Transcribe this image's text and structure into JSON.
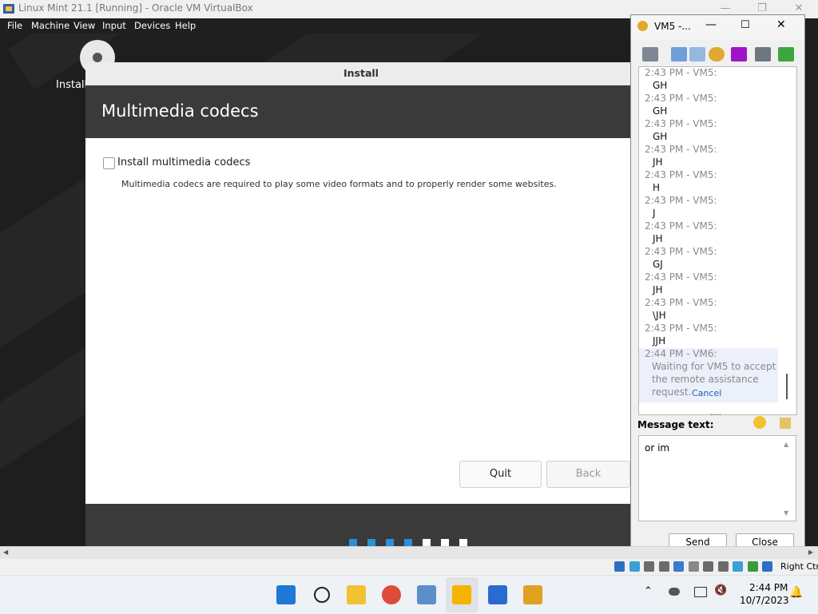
{
  "host_window": {
    "title": "Linux Mint 21.1 [Running] - Oracle VM VirtualBox",
    "menu": [
      "File",
      "Machine",
      "View",
      "Input",
      "Devices",
      "Help"
    ]
  },
  "desktop": {
    "icon_label": "Install"
  },
  "installer": {
    "window_title": "Install",
    "header": "Multimedia codecs",
    "checkbox_label": "Install multimedia codecs",
    "checkbox_checked": false,
    "description": "Multimedia codecs are required to play some video formats and to properly render some websites.",
    "buttons": {
      "quit": "Quit",
      "back": "Back"
    },
    "progress_total_steps": 7,
    "progress_completed_steps": 4
  },
  "chat": {
    "window_title": "VM5 -...",
    "messages": [
      {
        "header": "2:43 PM - VM5:",
        "body": "GH"
      },
      {
        "header": "2:43 PM - VM5:",
        "body": "GH"
      },
      {
        "header": "2:43 PM - VM5:",
        "body": "GH"
      },
      {
        "header": "2:43 PM - VM5:",
        "body": "JH"
      },
      {
        "header": "2:43 PM - VM5:",
        "body": "H"
      },
      {
        "header": "2:43 PM - VM5:",
        "body": "J"
      },
      {
        "header": "2:43 PM - VM5:",
        "body": "JH"
      },
      {
        "header": "2:43 PM - VM5:",
        "body": "GJ"
      },
      {
        "header": "2:43 PM - VM5:",
        "body": "JH"
      },
      {
        "header": "2:43 PM - VM5:",
        "body": "\\JH"
      },
      {
        "header": "2:43 PM - VM5:",
        "body": "JJH"
      }
    ],
    "pending": {
      "header": "2:44 PM - VM6:",
      "lines": [
        "Waiting for VM5 to accept",
        "the remote assistance",
        "request."
      ],
      "cancel": "Cancel"
    },
    "message_label": "Message text:",
    "message_value": "or im",
    "send": "Send",
    "close": "Close"
  },
  "statusbar": {
    "host_key": "Right Ctrl"
  },
  "taskbar": {
    "time": "2:44 PM",
    "date": "10/7/2023",
    "apps": [
      "start-icon",
      "search-icon",
      "file-explorer-icon",
      "chrome-icon",
      "photos-icon",
      "chat-app-icon",
      "virtualbox-icon",
      "file-manager-icon"
    ]
  },
  "colors": {
    "progress_done": "#2d8fd5",
    "progress_todo": "#ffffff",
    "header_bg": "#3a3a3a",
    "link": "#1a5fb4"
  }
}
